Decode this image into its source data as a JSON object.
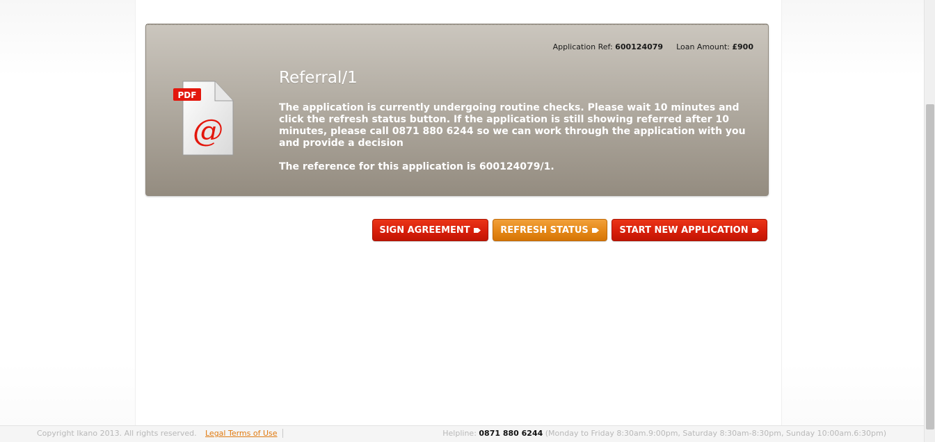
{
  "application": {
    "ref_label": "Application Ref:",
    "ref_value": "600124079",
    "amount_label": "Loan Amount:",
    "amount_value": "£900"
  },
  "status": {
    "title": "Referral/1",
    "message": "The application is currently undergoing routine checks. Please wait 10 minutes and click the refresh status button. If the application is still showing referred after 10 minutes, please call 0871 880 6244 so we can work through the application with you and provide a decision",
    "reference_text": "The reference for this application is 600124079/1.",
    "icon": "pdf-email-document-icon",
    "icon_badge": "PDF",
    "icon_symbol": "@"
  },
  "actions": {
    "sign_label": "SIGN AGREEMENT",
    "refresh_label": "REFRESH STATUS",
    "new_label": "START NEW APPLICATION"
  },
  "footer": {
    "copyright": "Copyright Ikano 2013. All rights reserved.",
    "legal_link": "Legal Terms of Use",
    "helpline_label": "Helpline:",
    "helpline_number": "0871 880 6244",
    "helpline_hours": "(Monday to Friday 8:30am.9:00pm, Saturday 8:30am-8:30pm, Sunday 10:00am.6:30pm)"
  },
  "colors": {
    "primary_button": "#d81f0b",
    "secondary_button": "#e58817",
    "link": "#e07a10"
  }
}
